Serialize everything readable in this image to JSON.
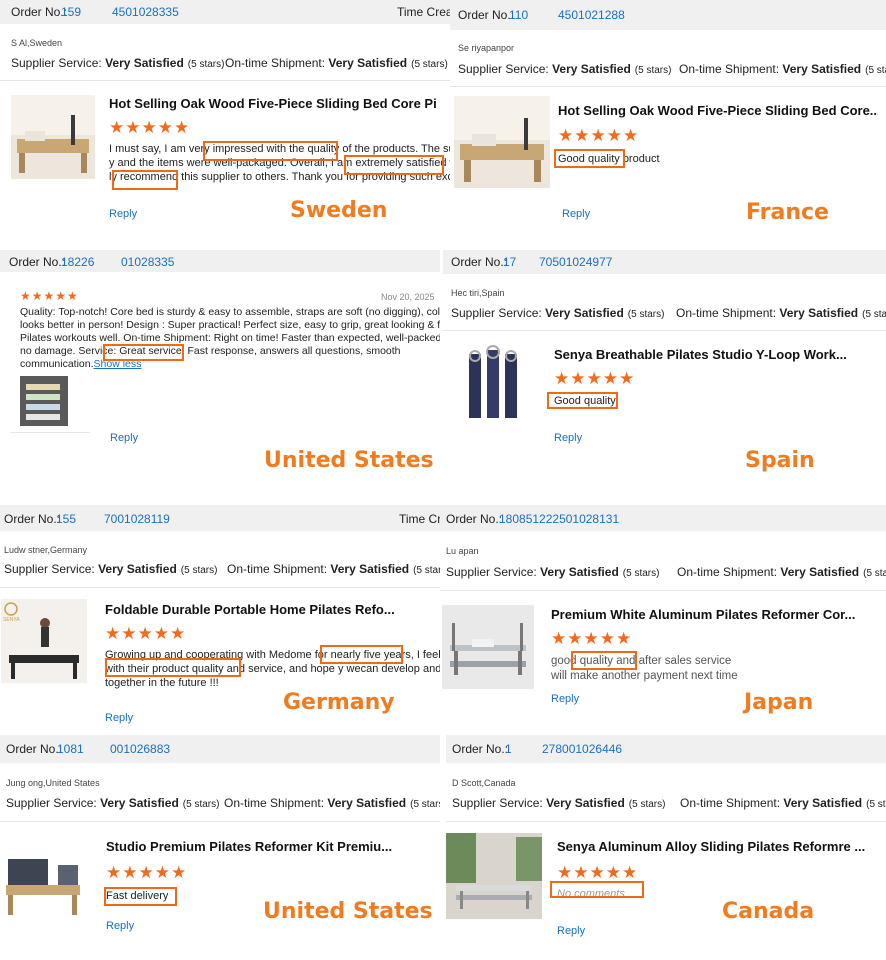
{
  "common": {
    "order_label": "Order No.:",
    "supplier_service": "Supplier Service:",
    "ontime_shipment": "On-time Shipment:",
    "very_satisfied": "Very Satisfied",
    "five_stars": "(5 stars)",
    "reply": "Reply",
    "stars": "★★★★★",
    "time_created": "Time Create",
    "time_created_b": "Time Cre"
  },
  "reviews": [
    {
      "country": "Sweden",
      "order_no_a": "159",
      "order_no_b": "4501028335",
      "customer": "S        Al,Sweden",
      "product": "Hot Selling Oak Wood Five-Piece Sliding Bed Core Pi ...",
      "lines": [
        "I must say, I am very impressed with the quality of the products. The supplier was",
        "y and the items were well-packaged. Overall, I am extremely satisfied with my exp",
        "ly recommend this supplier to others. Thank you for providing such excellent quali"
      ]
    },
    {
      "country": "France",
      "order_no_a": "110",
      "order_no_b": "4501021288",
      "customer": "Se         riyapanpor",
      "product": "Hot Selling Oak Wood Five-Piece Sliding Bed Core...",
      "lines": [
        "Good quality product"
      ]
    },
    {
      "country": "United States",
      "order_no_a": "18226",
      "order_no_b": "01028335",
      "date": "Nov 20, 2025",
      "lines": [
        "Quality: Top-notch! Core bed is sturdy & easy to assemble, straps are soft (no digging), color",
        "looks better in person! Design : Super practical! Perfect size, easy to grip, great looking & fits",
        "Pilates workouts well. On-time Shipment: Right on time! Faster than expected, well-packed &",
        "no damage. Service: Great service! Fast response, answers all questions, smooth",
        "communication."
      ],
      "show_less": "Show less"
    },
    {
      "country": "Spain",
      "order_no_a": "17",
      "order_no_b": "70501024977",
      "customer": "Hec         tiri,Spain",
      "product": "Senya Breathable Pilates Studio Y-Loop Work...",
      "lines": [
        "Good quality"
      ]
    },
    {
      "country": "Germany",
      "order_no_a": "155",
      "order_no_b": "7001028119",
      "customer": "Ludw         stner,Germany",
      "product": "Foldable Durable Portable Home Pilates Refo...",
      "lines": [
        "Growing up and cooperating with Medome for nearly five years, I feel ve",
        "with their product quality and service, and hope y wecan develop and e",
        "together in the future !!!"
      ],
      "brand": "SENYA"
    },
    {
      "country": "Japan",
      "order_no_a": "180851222501028131",
      "order_no_b": "",
      "customer": "Lu          apan",
      "product": "Premium White Aluminum Pilates Reformer Cor...",
      "lines": [
        "good quality and after sales service",
        "will make another payment next time"
      ]
    },
    {
      "country": "United States",
      "order_no_a": "1081",
      "order_no_b": "001026883",
      "customer": "Jung        ong,United States",
      "product": "Studio Premium Pilates Reformer Kit Premiu...",
      "lines": [
        "Fast delivery"
      ]
    },
    {
      "country": "Canada",
      "order_no_a": "1",
      "order_no_b": "278001026446",
      "customer": "D          Scott,Canada",
      "product": "Senya Aluminum Alloy Sliding Pilates Reformre ...",
      "lines": [
        "No comments"
      ]
    }
  ],
  "colors": {
    "accent": "#f07c22",
    "star": "#f26b1d",
    "link": "#1a6fc4",
    "highlight": "#ef6a16"
  }
}
